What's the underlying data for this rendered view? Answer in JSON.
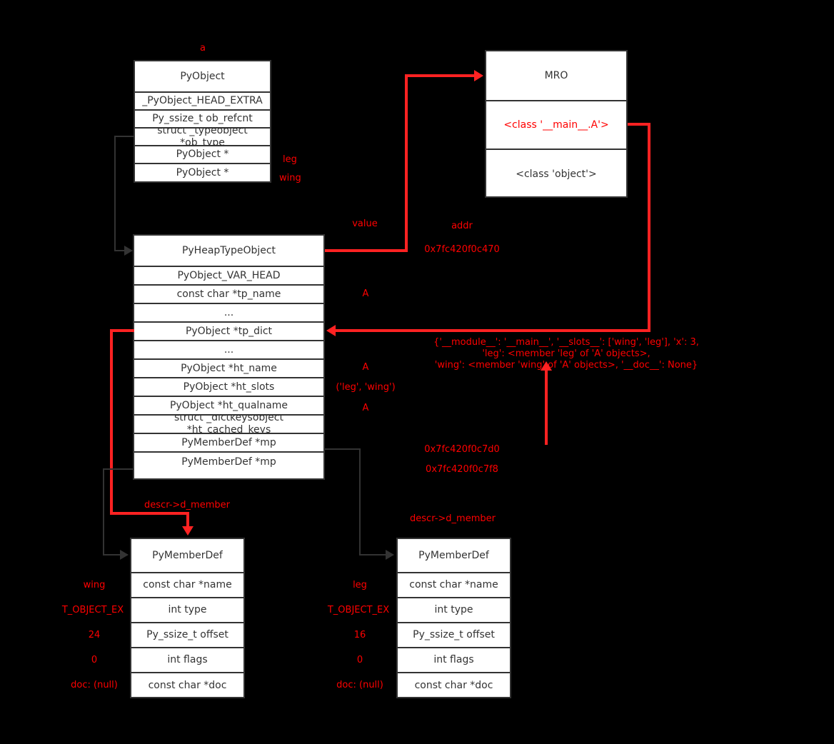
{
  "diagram": {
    "title_labels": {
      "instance": "a"
    },
    "boxes": {
      "pyobject": {
        "header": "PyObject",
        "rows": [
          "_PyObject_HEAD_EXTRA",
          "Py_ssize_t ob_refcnt",
          "struct _typeobject\n*ob_type",
          "PyObject *",
          "PyObject *"
        ],
        "side_labels": {
          "leg": "leg",
          "wing": "wing"
        }
      },
      "mro": {
        "header": "MRO",
        "rows": [
          "<class '__main__.A'>",
          "<class 'object'>"
        ]
      },
      "pyheaptypeobject": {
        "header": "PyHeapTypeObject",
        "rows": [
          "PyObject_VAR_HEAD",
          "const char *tp_name",
          "...",
          "PyObject *tp_dict",
          "...",
          "PyObject *ht_name",
          "PyObject *ht_slots",
          "PyObject *ht_qualname",
          "struct _dictkeysobject\n*ht_cached_keys",
          "PyMemberDef *mp",
          "PyMemberDef *mp"
        ]
      },
      "membderdef_wing": {
        "header": "PyMemberDef",
        "rows": [
          "const char *name",
          "int type",
          "Py_ssize_t offset",
          "int flags",
          "const char *doc"
        ],
        "values": [
          "wing",
          "T_OBJECT_EX",
          "24",
          "0",
          "doc: (null)"
        ],
        "pointer_label": "descr->d_member"
      },
      "membderdef_leg": {
        "header": "PyMemberDef",
        "rows": [
          "const char *name",
          "int type",
          "Py_ssize_t offset",
          "int flags",
          "const char *doc"
        ],
        "values": [
          "leg",
          "T_OBJECT_EX",
          "16",
          "0",
          "doc: (null)"
        ],
        "pointer_label": "descr->d_member"
      }
    },
    "annotations": {
      "value": "value",
      "addr": "addr",
      "addr_value": "0x7fc420f0c470",
      "a_tp_name": "A",
      "a_ht_name": "A",
      "a_ht_qualname": "A",
      "ht_slots_value": "('leg', 'wing')",
      "tp_dict_value": "{'__module__': '__main__', '__slots__': ['wing', 'leg'], 'x': 3, 'leg': <member 'leg' of 'A' objects>,\n'wing': <member 'wing' of 'A' objects>, '__doc__': None}",
      "mp_addr_1": "0x7fc420f0c7d0",
      "mp_addr_2": "0x7fc420f0c7f8"
    },
    "colors": {
      "background": "#000000",
      "box_fill": "#ffffff",
      "box_border": "#333333",
      "text": "#333333",
      "accent_red": "#ff0000",
      "line_red": "#ff2222",
      "line_gray": "#333333"
    }
  }
}
